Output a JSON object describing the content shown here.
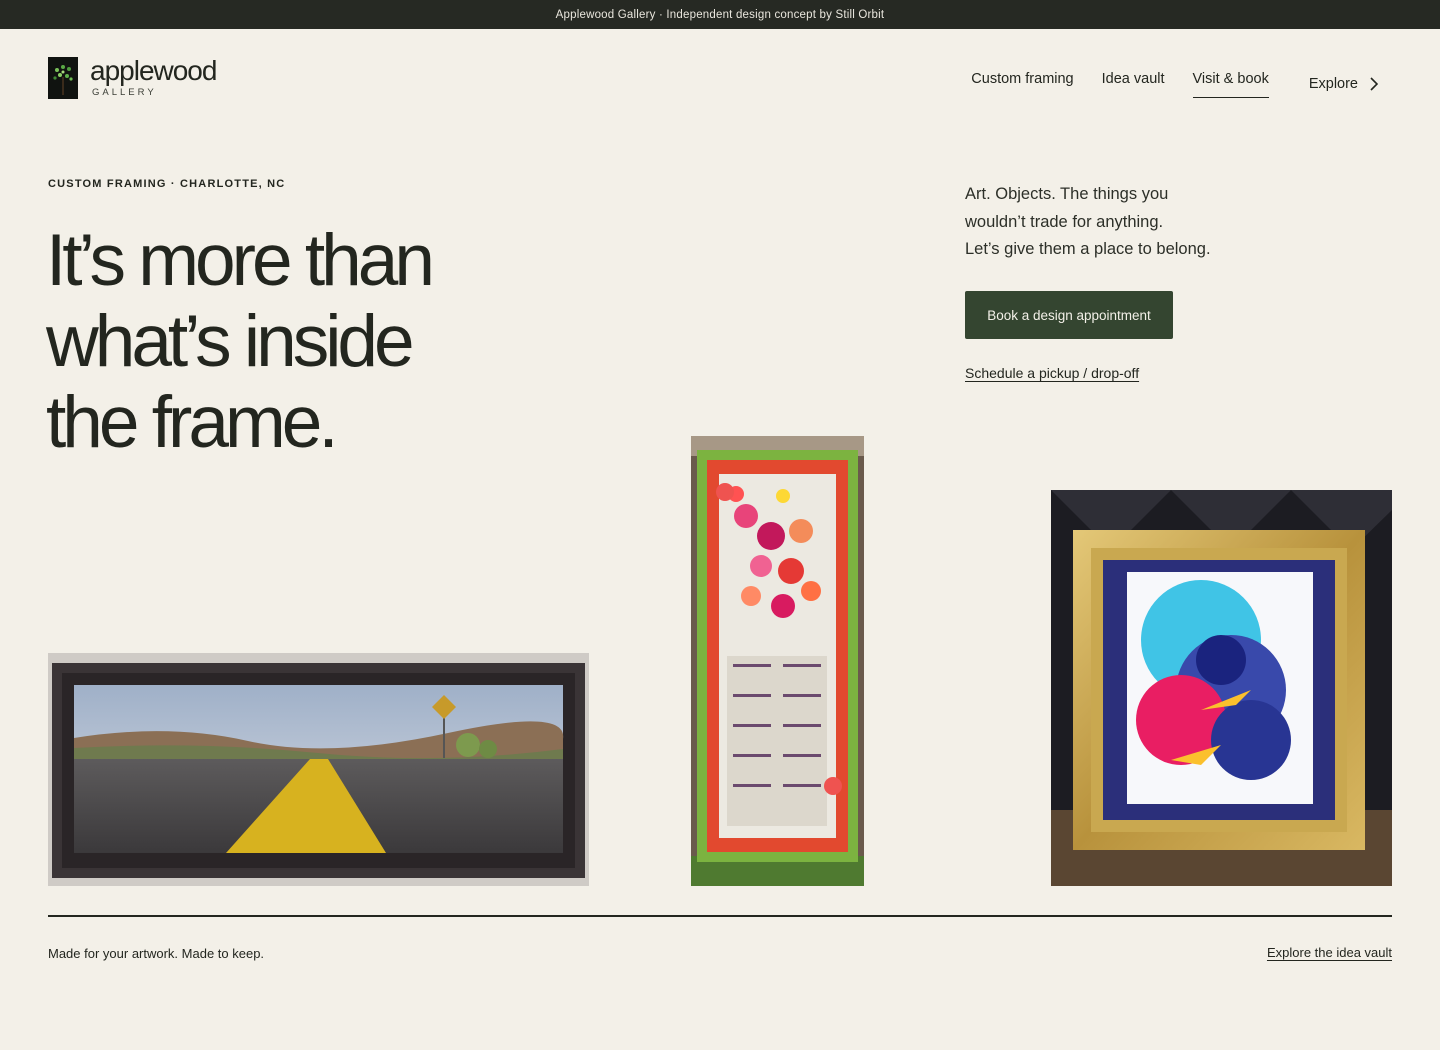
{
  "topbar": {
    "text": "Applewood Gallery · Independent design concept by Still Orbit"
  },
  "brand": {
    "name": "applewood",
    "subtitle": "GALLERY"
  },
  "nav": {
    "items": [
      {
        "label": "Custom framing",
        "active": false
      },
      {
        "label": "Idea vault",
        "active": false
      },
      {
        "label": "Visit & book",
        "active": true
      },
      {
        "label": "Explore",
        "active": false
      }
    ]
  },
  "hero": {
    "eyebrow": "CUSTOM FRAMING · CHARLOTTE, NC",
    "headline": [
      "It’s more than",
      "what’s inside",
      "the frame."
    ],
    "intro": [
      "Art. Objects. The things you",
      "wouldn’t trade for anything.",
      "Let’s give them a place to belong."
    ],
    "primary_cta": "Book a design appointment",
    "secondary_cta": "Schedule a pickup / drop-off"
  },
  "gallery": {
    "images": [
      {
        "alt": "Framed panoramic photo of a desert highway"
      },
      {
        "alt": "Green-framed floral 1976 calendar tea towel"
      },
      {
        "alt": "Gold ornate frame with abstract painting"
      }
    ]
  },
  "footer": {
    "tagline": "Made for your artwork. Made to keep.",
    "link": "Explore the idea vault"
  },
  "colors": {
    "background": "#f3f0e8",
    "topbar": "#262923",
    "accent": "#344530",
    "text": "#23261f"
  }
}
